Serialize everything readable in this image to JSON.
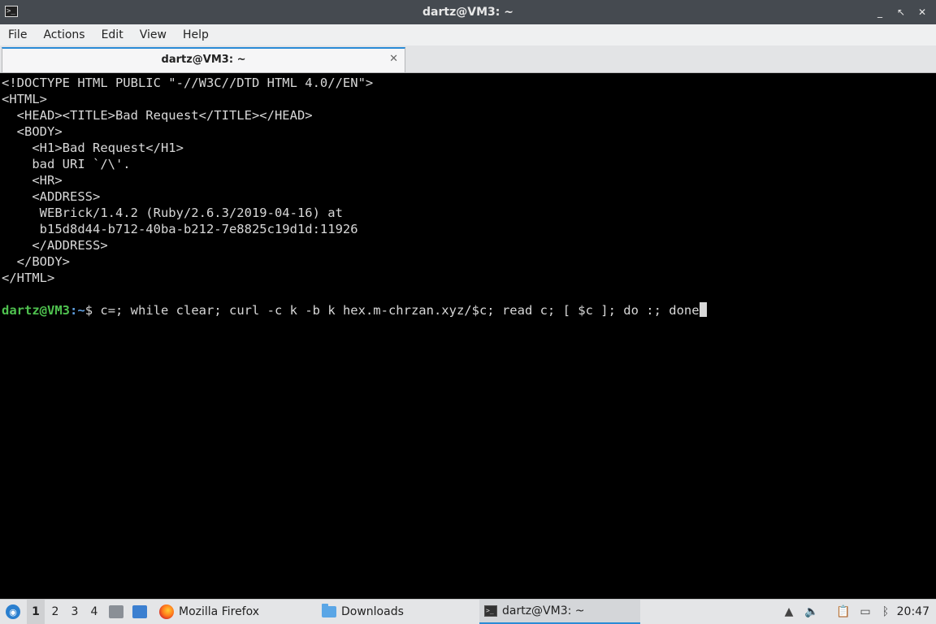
{
  "window": {
    "title": "dartz@VM3: ~",
    "controls": {
      "minimize": "_",
      "maximize": "↖",
      "close": "✕"
    },
    "app_icon_glyph": ">_"
  },
  "menu": [
    "File",
    "Actions",
    "Edit",
    "View",
    "Help"
  ],
  "tabs": [
    {
      "label": "dartz@VM3: ~",
      "close": "✕"
    }
  ],
  "terminal": {
    "output_lines": [
      "<!DOCTYPE HTML PUBLIC \"-//W3C//DTD HTML 4.0//EN\">",
      "<HTML>",
      "  <HEAD><TITLE>Bad Request</TITLE></HEAD>",
      "  <BODY>",
      "    <H1>Bad Request</H1>",
      "    bad URI `/\\'.",
      "    <HR>",
      "    <ADDRESS>",
      "     WEBrick/1.4.2 (Ruby/2.6.3/2019-04-16) at",
      "     b15d8d44-b712-40ba-b212-7e8825c19d1d:11926",
      "    </ADDRESS>",
      "  </BODY>",
      "</HTML>",
      ""
    ],
    "prompt": {
      "user_host": "dartz@VM3",
      "separator": ":",
      "path": "~",
      "symbol": "$ ",
      "command": "c=; while clear; curl -c k -b k hex.m-chrzan.xyz/$c; read c; [ $c ]; do :; done"
    }
  },
  "taskbar": {
    "workspaces": [
      "1",
      "2",
      "3",
      "4"
    ],
    "active_workspace": "1",
    "tasks": [
      {
        "label": "Mozilla Firefox",
        "icon": "firefox-icon"
      },
      {
        "label": "Downloads",
        "icon": "folder-icon"
      },
      {
        "label": "dartz@VM3: ~",
        "icon": "terminal-icon",
        "active": true
      }
    ],
    "clock": "20:47"
  },
  "colors": {
    "prompt_user": "#4fc24f",
    "prompt_path": "#5f9fe0",
    "terminal_bg": "#000000",
    "terminal_fg": "#d8d8d8",
    "accent": "#2a8bd6"
  }
}
